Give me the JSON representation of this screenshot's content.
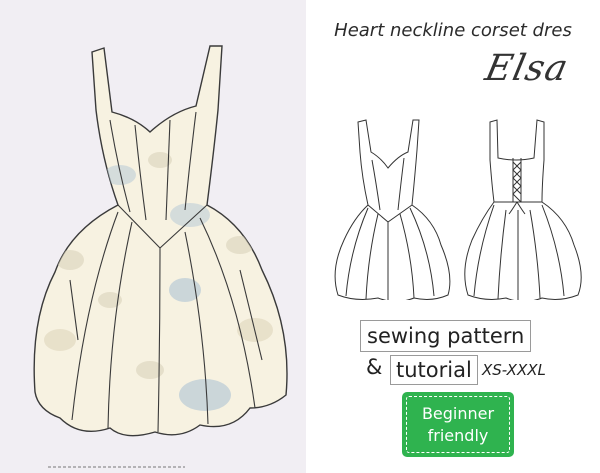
{
  "title": "Heart neckline corset dres",
  "pattern_name": "Elsa",
  "tags": {
    "sewing_pattern": "sewing pattern",
    "ampersand": "&",
    "tutorial": "tutorial",
    "sizes": "XS-XXXL"
  },
  "badge": {
    "line1": "Beginner",
    "line2": "friendly"
  },
  "colors": {
    "left_background": "#f1eef3",
    "fabric": "#f7f2e1",
    "badge": "#2fb34f"
  }
}
